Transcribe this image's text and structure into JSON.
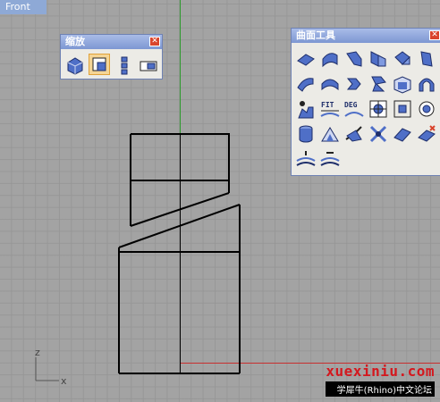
{
  "viewport": {
    "label": "Front"
  },
  "axes": {
    "x_label": "x",
    "z_label": "z"
  },
  "zoom_panel": {
    "title": "缩放",
    "tools": [
      {
        "name": "zoom-extents-icon",
        "active": false
      },
      {
        "name": "zoom-window-icon",
        "active": true
      },
      {
        "name": "zoom-dynamic-icon",
        "active": false
      },
      {
        "name": "zoom-selected-icon",
        "active": false
      }
    ]
  },
  "surface_panel": {
    "title": "曲面工具",
    "rows": [
      [
        "fillet-surface-icon",
        "chamfer-surface-icon",
        "variable-fillet-icon",
        "blend-surface-icon",
        "match-surface-icon",
        "merge-surface-icon"
      ],
      [
        "extend-surface-icon",
        "offset-surface-icon",
        "variable-chamfer-icon",
        "connect-surface-icon",
        "unroll-surface-icon",
        "arch-surface-icon"
      ],
      [
        "change-degree-icon",
        "fit-icon",
        "deg-icon",
        "edit-point-icon",
        "rebuild-icon",
        "target-icon"
      ],
      [
        "cylinder-icon",
        "shrink-icon",
        "split-icon",
        "flow-icon",
        "symmetry-icon",
        "remove-icon"
      ],
      [
        "insert-knot-icon",
        "remove-knot-icon"
      ]
    ],
    "text_icons": {
      "fit": "FIT",
      "deg": "DEG"
    }
  },
  "watermark": {
    "title": "xuexiniu.com",
    "subtitle": "学犀牛(Rhino)中文论坛"
  }
}
